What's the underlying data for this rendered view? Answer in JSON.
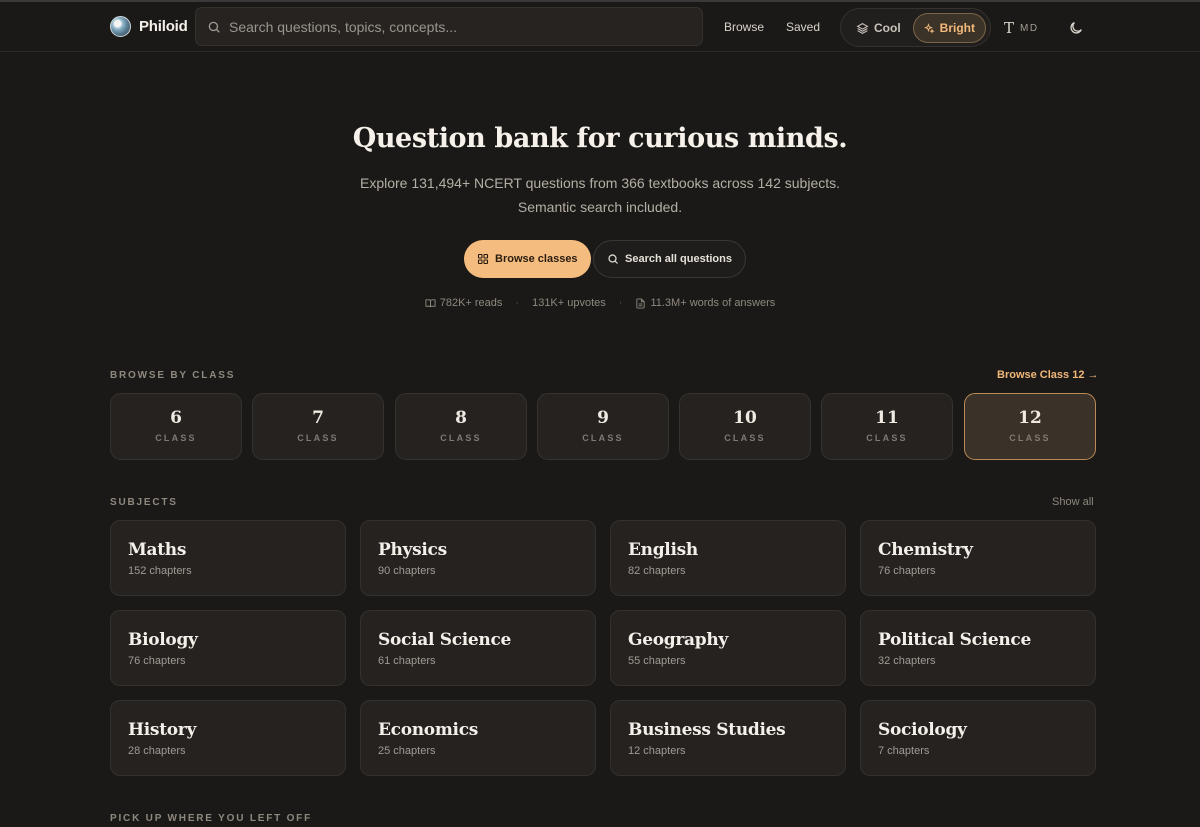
{
  "header": {
    "brand": "Philoid",
    "search_placeholder": "Search questions, topics, concepts...",
    "nav": {
      "browse": "Browse",
      "saved": "Saved"
    },
    "theme": {
      "cool": "Cool",
      "bright": "Bright",
      "selected": "Bright"
    },
    "font_size_label": "MD",
    "icons": [
      "logo-icon",
      "search-icon",
      "layers-icon",
      "sparkle-icon",
      "text-size-icon",
      "moon-icon"
    ]
  },
  "hero": {
    "title": "Question bank for curious minds.",
    "subtitle_line1": "Explore 131,494+ NCERT questions from 366 textbooks across 142 subjects.",
    "subtitle_line2": "Semantic search included.",
    "primary_button": "Browse classes",
    "secondary_button": "Search all questions",
    "stats": {
      "reads": "782K+ reads",
      "upvotes": "131K+ upvotes",
      "words": "11.3M+ words of answers"
    }
  },
  "browse_by_class": {
    "label": "BROWSE BY CLASS",
    "link": "Browse Class 12 →",
    "class_label": "CLASS",
    "classes": [
      "6",
      "7",
      "8",
      "9",
      "10",
      "11",
      "12"
    ],
    "selected": "12"
  },
  "subjects": {
    "label": "SUBJECTS",
    "show_all": "Show all",
    "items": [
      {
        "name": "Maths",
        "chapters": "152 chapters"
      },
      {
        "name": "Physics",
        "chapters": "90 chapters"
      },
      {
        "name": "English",
        "chapters": "82 chapters"
      },
      {
        "name": "Chemistry",
        "chapters": "76 chapters"
      },
      {
        "name": "Biology",
        "chapters": "76 chapters"
      },
      {
        "name": "Social Science",
        "chapters": "61 chapters"
      },
      {
        "name": "Geography",
        "chapters": "55 chapters"
      },
      {
        "name": "Political Science",
        "chapters": "32 chapters"
      },
      {
        "name": "History",
        "chapters": "28 chapters"
      },
      {
        "name": "Economics",
        "chapters": "25 chapters"
      },
      {
        "name": "Business Studies",
        "chapters": "12 chapters"
      },
      {
        "name": "Sociology",
        "chapters": "7 chapters"
      }
    ]
  },
  "continue": {
    "label": "PICK UP WHERE YOU LEFT OFF"
  },
  "colors": {
    "accent": "#f4bd7f",
    "background": "#1b1917",
    "card": "#252220"
  }
}
